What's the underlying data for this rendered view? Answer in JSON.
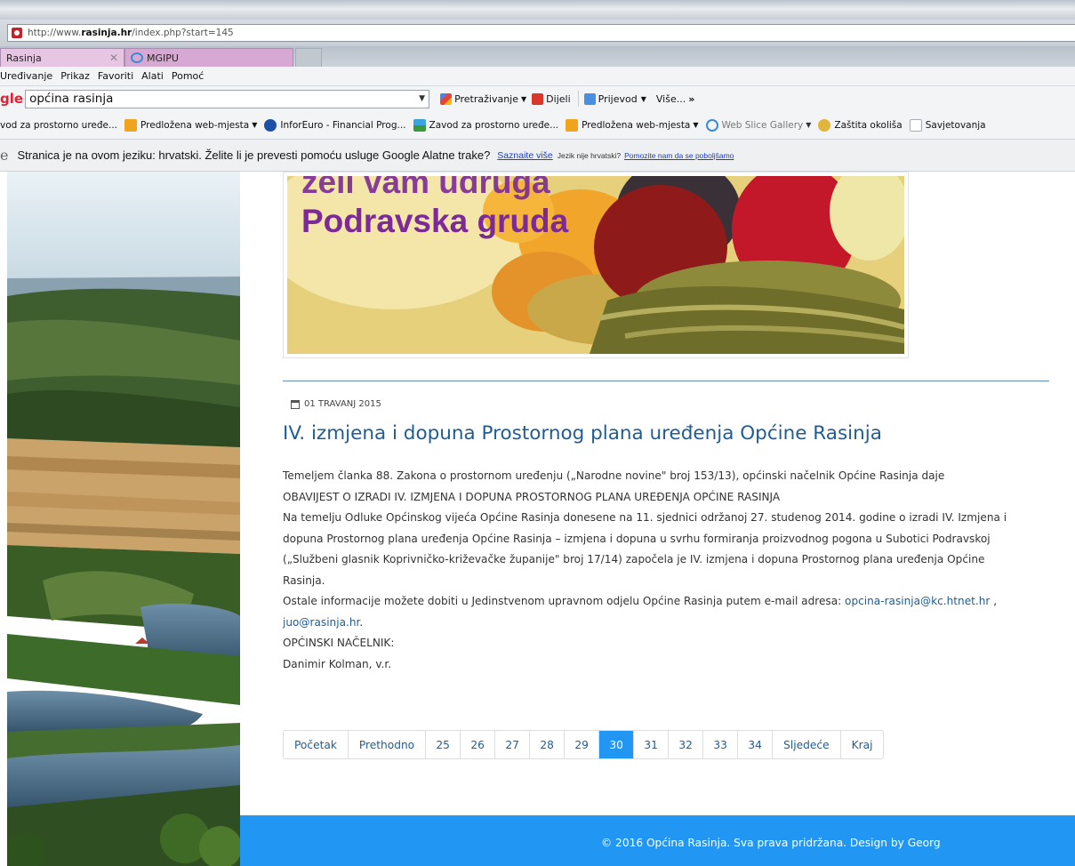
{
  "browser": {
    "url_prefix": "http://www.",
    "url_domain": "rasinja.hr",
    "url_path": "/index.php?start=145",
    "tabs": [
      {
        "label": "Rasinja"
      },
      {
        "label": "MGIPU"
      }
    ],
    "menu": [
      "Uređivanje",
      "Prikaz",
      "Favoriti",
      "Alati",
      "Pomoć"
    ],
    "toolbar": {
      "logo": "gle",
      "search_value": "općina rasinja",
      "search_btn": "Pretraživanje",
      "share_btn": "Dijeli",
      "translate_btn": "Prijevod",
      "more_btn": "Više..."
    },
    "favorites": [
      {
        "label": "vod za prostorno uređe...",
        "dropdown": false,
        "gray": false
      },
      {
        "label": "Predložena web-mjesta",
        "dropdown": true,
        "gray": false
      },
      {
        "label": "InforEuro - Financial Prog...",
        "dropdown": false,
        "gray": false
      },
      {
        "label": "Zavod za prostorno uređe...",
        "dropdown": false,
        "gray": false
      },
      {
        "label": "Predložena web-mjesta",
        "dropdown": true,
        "gray": false
      },
      {
        "label": "Web Slice Gallery",
        "dropdown": true,
        "gray": true
      },
      {
        "label": "Zaštita okoliša",
        "dropdown": false,
        "gray": false
      },
      {
        "label": "Savjetovanja",
        "dropdown": false,
        "gray": false
      }
    ],
    "translate_bar": {
      "text": "Stranica je na ovom jeziku: hrvatski. Želite li je prevesti pomoću usluge Google Alatne trake?",
      "learn_more": "Saznaite više",
      "not_croatian": "Jezik nije hrvatski?",
      "help_link": "Pomozite nam da se poboljšamo"
    }
  },
  "banner": {
    "line1": "želi vam udruga",
    "line2": "Podravska gruda"
  },
  "article": {
    "date": "01 TRAVANJ 2015",
    "title": "IV. izmjena i dopuna Prostornog plana uređenja Općine Rasinja",
    "paragraphs": [
      "Temeljem članka 88. Zakona o prostornom uređenju („Narodne novine\" broj 153/13), općinski načelnik Općine Rasinja daje",
      "OBAVIJEST O IZRADI IV. IZMJENA I DOPUNA PROSTORNOG PLANA UREĐENJA OPĆINE RASINJA",
      "Na temelju Odluke Općinskog vijeća Općine Rasinja donesene na 11. sjednici održanoj 27. studenog 2014. godine o izradi IV. Izmjena i",
      "dopuna Prostornog plana uređenja Općine Rasinja – izmjena i dopuna u svrhu formiranja proizvodnog pogona u Subotici Podravskoj",
      "(„Službeni glasnik Koprivničko-križevačke županije\" broj 17/14) započela je IV. izmjena i dopuna Prostornog plana uređenja Općine",
      "Rasinja."
    ],
    "contact_text": "Ostale informacije možete dobiti u Jedinstvenom upravnom odjelu Općine Rasinja putem e-mail adresa: ",
    "email1": "opcina-rasinja@kc.htnet.hr",
    "email_sep": " ,",
    "email2": "juo@rasinja.hr",
    "email2_end": ".",
    "signature_role": "OPĆINSKI NAČELNIK:",
    "signature_name": "Danimir Kolman, v.r."
  },
  "pagination": {
    "first": "Početak",
    "prev": "Prethodno",
    "pages": [
      "25",
      "26",
      "27",
      "28",
      "29",
      "30",
      "31",
      "32",
      "33",
      "34"
    ],
    "active": "30",
    "next": "Sljedeće",
    "last": "Kraj"
  },
  "footer": {
    "text": "© 2016 Općina Rasinja. Sva prava pridržana. Design by Georg"
  },
  "colors": {
    "accent_blue": "#2196f3",
    "link_blue": "#1f5d96",
    "banner_text": "#7b2a97"
  }
}
